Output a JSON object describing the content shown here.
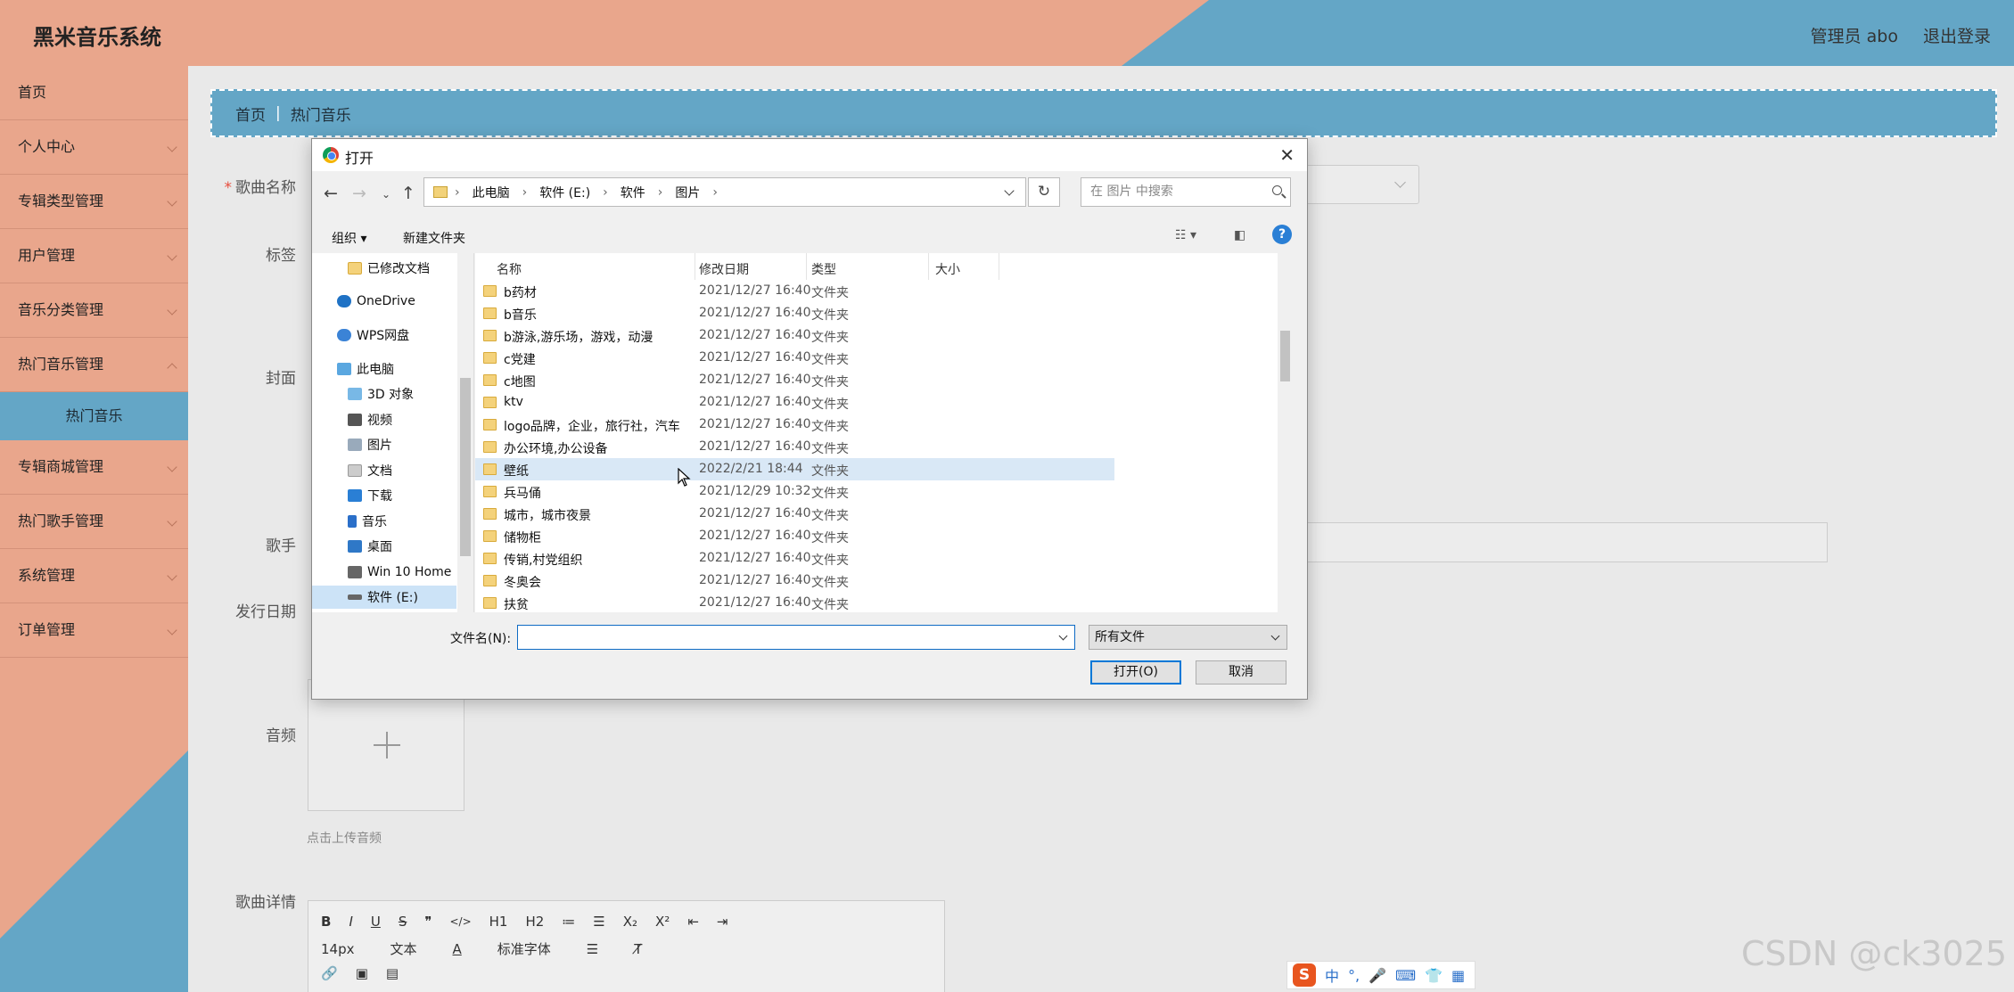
{
  "header": {
    "title": "黑米音乐系统",
    "admin": "管理员 abo",
    "logout": "退出登录"
  },
  "sidebar": {
    "items": [
      {
        "label": "首页"
      },
      {
        "label": "个人中心"
      },
      {
        "label": "专辑类型管理"
      },
      {
        "label": "用户管理"
      },
      {
        "label": "音乐分类管理"
      },
      {
        "label": "热门音乐管理"
      },
      {
        "label": "热门音乐"
      },
      {
        "label": "专辑商城管理"
      },
      {
        "label": "热门歌手管理"
      },
      {
        "label": "系统管理"
      },
      {
        "label": "订单管理"
      }
    ]
  },
  "breadcrumb": {
    "home": "首页",
    "sep": "|",
    "current": "热门音乐"
  },
  "form": {
    "song_name_label": "歌曲名称",
    "tag_label": "标签",
    "cover_label": "封面",
    "singer_label": "歌手",
    "release_label": "发行日期",
    "audio_label": "音频",
    "audio_hint": "点击上传音频",
    "detail_label": "歌曲详情"
  },
  "editor": {
    "toolbar1": [
      "B",
      "I",
      "U",
      "S",
      "❞",
      "</>",
      "H1",
      "H2",
      "≔",
      "☰",
      "X₂",
      "X²",
      "⇤",
      "⇥"
    ],
    "font_size": "14px",
    "text_type": "文本",
    "font_family": "标准字体",
    "toolbar2_icons": [
      "link-icon",
      "image-icon",
      "video-icon"
    ]
  },
  "dialog": {
    "title": "打开",
    "address": [
      "此电脑",
      "软件 (E:)",
      "软件",
      "图片"
    ],
    "search_placeholder": "在 图片 中搜索",
    "organize": "组织 ▾",
    "new_folder": "新建文件夹",
    "nav": [
      {
        "label": "已修改文档",
        "icon": "folder"
      },
      {
        "label": "OneDrive",
        "icon": "cloud"
      },
      {
        "label": "WPS网盘",
        "icon": "cloud"
      },
      {
        "label": "此电脑",
        "icon": "pc"
      },
      {
        "label": "3D 对象",
        "icon": "3d"
      },
      {
        "label": "视频",
        "icon": "video"
      },
      {
        "label": "图片",
        "icon": "picture"
      },
      {
        "label": "文档",
        "icon": "doc"
      },
      {
        "label": "下载",
        "icon": "download"
      },
      {
        "label": "音乐",
        "icon": "music"
      },
      {
        "label": "桌面",
        "icon": "desktop"
      },
      {
        "label": "Win 10 Home",
        "icon": "drive"
      },
      {
        "label": "软件 (E:)",
        "icon": "drive"
      }
    ],
    "columns": {
      "name": "名称",
      "date": "修改日期",
      "type": "类型",
      "size": "大小"
    },
    "files": [
      {
        "name": "b药材",
        "date": "2021/12/27 16:40",
        "type": "文件夹"
      },
      {
        "name": "b音乐",
        "date": "2021/12/27 16:40",
        "type": "文件夹"
      },
      {
        "name": "b游泳,游乐场，游戏，动漫",
        "date": "2021/12/27 16:40",
        "type": "文件夹"
      },
      {
        "name": "c党建",
        "date": "2021/12/27 16:40",
        "type": "文件夹"
      },
      {
        "name": "c地图",
        "date": "2021/12/27 16:40",
        "type": "文件夹"
      },
      {
        "name": "ktv",
        "date": "2021/12/27 16:40",
        "type": "文件夹"
      },
      {
        "name": "logo品牌，企业，旅行社，汽车",
        "date": "2021/12/27 16:40",
        "type": "文件夹"
      },
      {
        "name": "办公环境,办公设备",
        "date": "2021/12/27 16:40",
        "type": "文件夹"
      },
      {
        "name": "壁纸",
        "date": "2022/2/21 18:44",
        "type": "文件夹"
      },
      {
        "name": "兵马俑",
        "date": "2021/12/29 10:32",
        "type": "文件夹"
      },
      {
        "name": "城市，城市夜景",
        "date": "2021/12/27 16:40",
        "type": "文件夹"
      },
      {
        "name": "储物柜",
        "date": "2021/12/27 16:40",
        "type": "文件夹"
      },
      {
        "name": "传销,村党组织",
        "date": "2021/12/27 16:40",
        "type": "文件夹"
      },
      {
        "name": "冬奥会",
        "date": "2021/12/27 16:40",
        "type": "文件夹"
      },
      {
        "name": "扶贫",
        "date": "2021/12/27 16:40",
        "type": "文件夹"
      }
    ],
    "filename_label": "文件名(N):",
    "filename_value": "",
    "filetype": "所有文件",
    "open_button": "打开(O)",
    "cancel_button": "取消"
  },
  "ime": {
    "logo": "S",
    "mode": "中",
    "icons": [
      "punct-icon",
      "mic-icon",
      "keyboard-icon",
      "skin-icon",
      "toolbox-icon"
    ]
  },
  "watermark": "CSDN @ck3025",
  "colors": {
    "salmon": "#e9a68c",
    "blue": "#64a6c6"
  }
}
